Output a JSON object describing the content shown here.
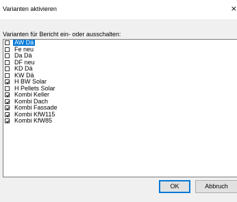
{
  "window": {
    "title": "Varianten aktivieren",
    "close_glyph": "×"
  },
  "prompt": "Varianten für Bericht ein- oder ausschalten:",
  "variants": [
    {
      "label": "AW Dä",
      "checked": false,
      "selected": true
    },
    {
      "label": "Fe neu",
      "checked": false,
      "selected": false
    },
    {
      "label": "Da Dä",
      "checked": false,
      "selected": false
    },
    {
      "label": "DF neu",
      "checked": false,
      "selected": false
    },
    {
      "label": "KD Dä",
      "checked": false,
      "selected": false
    },
    {
      "label": "KW Dä",
      "checked": false,
      "selected": false
    },
    {
      "label": "H BW Solar",
      "checked": true,
      "selected": false
    },
    {
      "label": "H Pellets Solar",
      "checked": false,
      "selected": false
    },
    {
      "label": "Kombi Keller",
      "checked": true,
      "selected": false
    },
    {
      "label": "Kombi Dach",
      "checked": true,
      "selected": false
    },
    {
      "label": "Kombi Fassade",
      "checked": true,
      "selected": false
    },
    {
      "label": "Kombi KfW115",
      "checked": true,
      "selected": false
    },
    {
      "label": "Kombi KfW85",
      "checked": true,
      "selected": false
    }
  ],
  "buttons": {
    "ok": "OK",
    "cancel": "Abbruch"
  },
  "colors": {
    "selection": "#0078d7",
    "dialog_bg": "#f0f0f0"
  }
}
